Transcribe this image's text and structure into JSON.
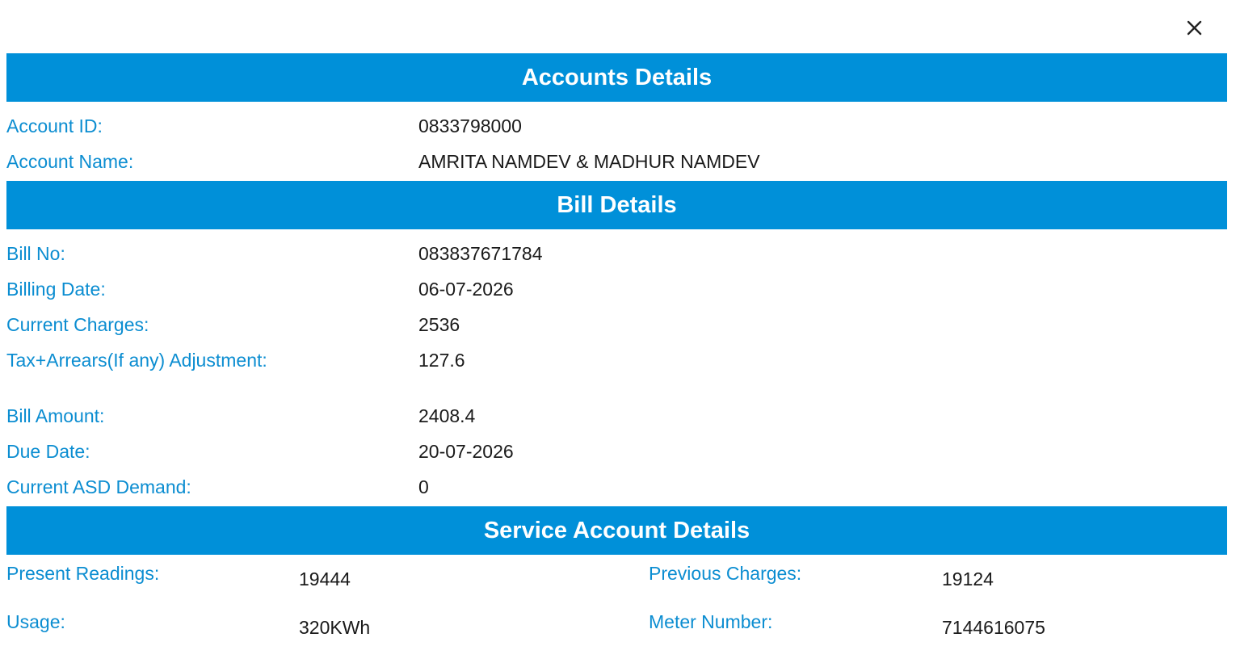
{
  "close_icon": "close-icon",
  "accent_color": "#0090d9",
  "label_color": "#0b8dd1",
  "accounts": {
    "title": "Accounts Details",
    "rows": [
      {
        "label": "Account ID:",
        "value": "0833798000"
      },
      {
        "label": "Account Name:",
        "value": "AMRITA NAMDEV & MADHUR NAMDEV"
      }
    ]
  },
  "bill": {
    "title": "Bill Details",
    "rows": [
      {
        "label": "Bill No:",
        "value": "083837671784"
      },
      {
        "label": "Billing Date:",
        "value": "06-07-2026"
      },
      {
        "label": "Current Charges:",
        "value": "2536"
      },
      {
        "label": "Tax+Arrears(If any) Adjustment:",
        "value": "127.6"
      },
      {
        "label": "Bill Amount:",
        "value": "2408.4"
      },
      {
        "label": "Due Date:",
        "value": "20-07-2026"
      },
      {
        "label": "Current ASD Demand:",
        "value": "0"
      }
    ]
  },
  "service": {
    "title": "Service Account Details",
    "present_readings_label": "Present Readings:",
    "present_readings_value": "19444",
    "previous_charges_label": "Previous Charges:",
    "previous_charges_value": "19124",
    "usage_label": "Usage:",
    "usage_value": "320KWh",
    "meter_number_label": "Meter Number:",
    "meter_number_value": "7144616075"
  }
}
